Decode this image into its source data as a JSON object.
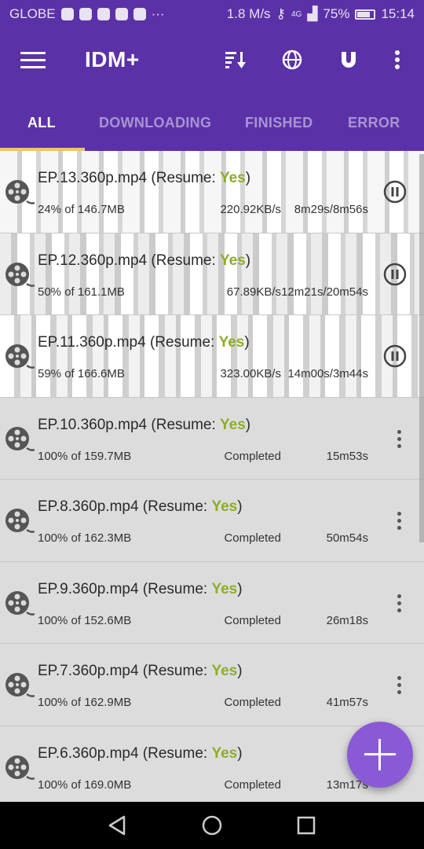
{
  "status_bar": {
    "carrier": "GLOBE",
    "more": "···",
    "speed": "1.8 M/s",
    "signal": "4G",
    "battery": "75%",
    "time": "15:14"
  },
  "app_bar": {
    "title": "IDM+",
    "icons": [
      "menu-icon",
      "sort-icon",
      "browser-icon",
      "magnet-icon",
      "more-vertical-icon"
    ]
  },
  "tabs": [
    {
      "label": "ALL",
      "active": true
    },
    {
      "label": "DOWNLOADING",
      "active": false
    },
    {
      "label": "FINISHED",
      "active": false
    },
    {
      "label": "ERROR",
      "active": false
    }
  ],
  "downloads": [
    {
      "file": "EP.13.360p.mp4",
      "resume_label": "Resume:",
      "resume": "Yes",
      "progress": "24% of 146.7MB",
      "speed": "220.92KB/s",
      "time": "8m29s/8m56s",
      "state": "downloading"
    },
    {
      "file": "EP.12.360p.mp4",
      "resume_label": "Resume:",
      "resume": "Yes",
      "progress": "50% of 161.1MB",
      "speed": "67.89KB/s",
      "time": "12m21s/20m54s",
      "state": "downloading"
    },
    {
      "file": "EP.11.360p.mp4",
      "resume_label": "Resume:",
      "resume": "Yes",
      "progress": "59% of 166.6MB",
      "speed": "323.00KB/s",
      "time": "14m00s/3m44s",
      "state": "downloading"
    },
    {
      "file": "EP.10.360p.mp4",
      "resume_label": "Resume:",
      "resume": "Yes",
      "progress": "100% of 159.7MB",
      "speed": "Completed",
      "time": "15m53s",
      "state": "completed"
    },
    {
      "file": "EP.8.360p.mp4",
      "resume_label": "Resume:",
      "resume": "Yes",
      "progress": "100% of 162.3MB",
      "speed": "Completed",
      "time": "50m54s",
      "state": "completed"
    },
    {
      "file": "EP.9.360p.mp4",
      "resume_label": "Resume:",
      "resume": "Yes",
      "progress": "100% of 152.6MB",
      "speed": "Completed",
      "time": "26m18s",
      "state": "completed"
    },
    {
      "file": "EP.7.360p.mp4",
      "resume_label": "Resume:",
      "resume": "Yes",
      "progress": "100% of 162.9MB",
      "speed": "Completed",
      "time": "41m57s",
      "state": "completed"
    },
    {
      "file": "EP.6.360p.mp4",
      "resume_label": "Resume:",
      "resume": "Yes",
      "progress": "100% of 169.0MB",
      "speed": "Completed",
      "time": "13m17s",
      "state": "completed"
    }
  ],
  "fab": {
    "icon": "add-icon"
  },
  "nav_bar": {
    "icons": [
      "back-icon",
      "home-icon",
      "recents-icon"
    ]
  },
  "colors": {
    "primary": "#5b31a8",
    "accent": "#8a5ad6",
    "tab_indicator": "#f0c46b",
    "resume_yes": "#8dae24"
  }
}
